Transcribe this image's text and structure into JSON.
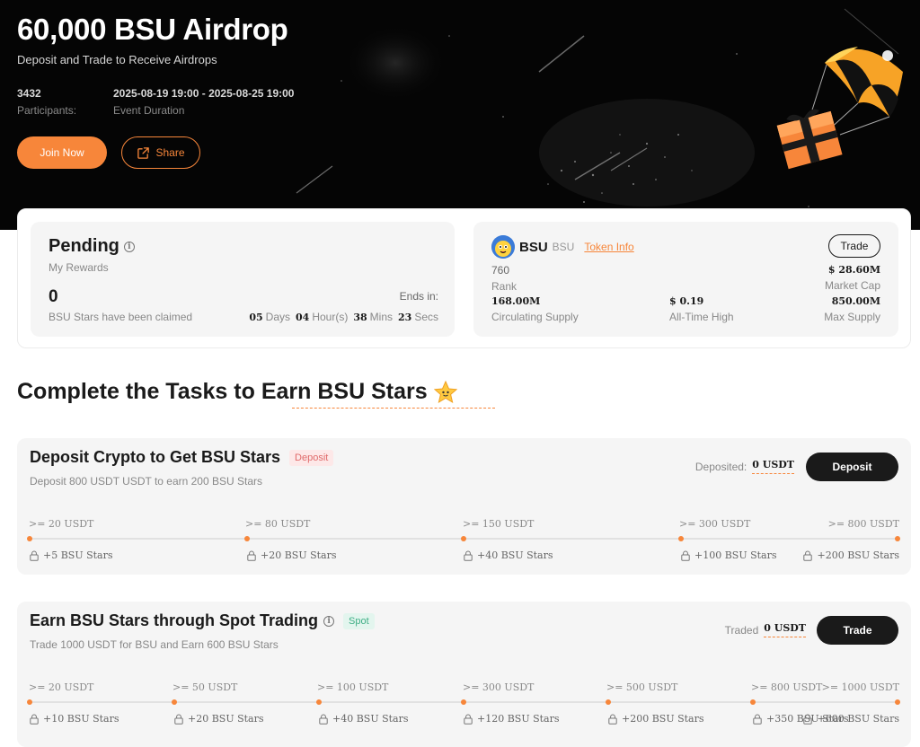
{
  "hero": {
    "title": "60,000 BSU Airdrop",
    "subtitle": "Deposit and Trade to Receive Airdrops",
    "participants_value": "3432",
    "participants_label": "Participants:",
    "duration_value": "2025-08-19 19:00 - 2025-08-25 19:00",
    "duration_label": "Event Duration",
    "join_label": "Join Now",
    "share_label": "Share",
    "share_icon": "share-icon",
    "illustration": "parachute-gift-box"
  },
  "pending": {
    "title": "Pending",
    "subtitle": "My Rewards",
    "count": "0",
    "claimed_text": "BSU Stars have been claimed",
    "ends_label": "Ends in:",
    "days": "05",
    "days_label": "Days",
    "hours": "04",
    "hours_label": "Hour(s)",
    "mins": "38",
    "mins_label": "Mins",
    "secs": "23",
    "secs_label": "Secs"
  },
  "token": {
    "symbol": "BSU",
    "symbol_small": "BSU",
    "info_link": "Token Info",
    "trade_label": "Trade",
    "rank_value": "760",
    "rank_label": "Rank",
    "market_cap_value": "$ 28.60M",
    "market_cap_label": "Market Cap",
    "circ_value": "168.00M",
    "circ_label": "Circulating Supply",
    "ath_value": "$ 0.19",
    "ath_label": "All-Time High",
    "max_value": "850.00M",
    "max_label": "Max Supply"
  },
  "tasks_heading": "Complete the Tasks to Earn BSU Stars",
  "task_deposit": {
    "title": "Deposit Crypto to Get BSU Stars",
    "tag": "Deposit",
    "subtitle": "Deposit 800 USDT USDT to earn 200 BSU Stars",
    "status_label": "Deposited:",
    "status_value": "0 USDT",
    "button_label": "Deposit",
    "milestones": [
      {
        "threshold": ">= 20 USDT",
        "reward": "+5 BSU Stars"
      },
      {
        "threshold": ">= 80 USDT",
        "reward": "+20 BSU Stars"
      },
      {
        "threshold": ">= 150 USDT",
        "reward": "+40 BSU Stars"
      },
      {
        "threshold": ">= 300 USDT",
        "reward": "+100 BSU Stars"
      },
      {
        "threshold": ">= 800 USDT",
        "reward": "+200 BSU Stars"
      }
    ]
  },
  "task_spot": {
    "title": "Earn BSU Stars through Spot Trading",
    "tag": "Spot",
    "subtitle": "Trade 1000 USDT for BSU and Earn 600 BSU Stars",
    "status_label": "Traded",
    "status_value": "0 USDT",
    "button_label": "Trade",
    "milestones": [
      {
        "threshold": ">= 20 USDT",
        "reward": "+10 BSU Stars"
      },
      {
        "threshold": ">= 50 USDT",
        "reward": "+20 BSU Stars"
      },
      {
        "threshold": ">= 100 USDT",
        "reward": "+40 BSU Stars"
      },
      {
        "threshold": ">= 300 USDT",
        "reward": "+120 BSU Stars"
      },
      {
        "threshold": ">= 500 USDT",
        "reward": "+200 BSU Stars"
      },
      {
        "threshold": ">= 800 USDT",
        "reward": "+350 BSU Stars"
      },
      {
        "threshold": ">= 1000 USDT",
        "reward": "+600 BSU Stars"
      }
    ]
  },
  "colors": {
    "accent": "#f7863a",
    "hero_bg": "#050505",
    "card_bg": "#f5f5f5",
    "dark_button": "#1a1a1a"
  }
}
